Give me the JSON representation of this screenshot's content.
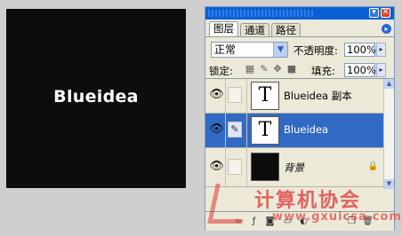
{
  "canvas": {
    "text": "Blueidea",
    "background": "#0d0e0c"
  },
  "panel": {
    "title_buttons": {
      "minimize": "▾",
      "close": "✕"
    },
    "tabs": [
      {
        "label": "图层",
        "active": true
      },
      {
        "label": "通道",
        "active": false
      },
      {
        "label": "路径",
        "active": false
      }
    ],
    "menu_arrow": "▸",
    "blend_mode": "正常",
    "opacity_label": "不透明度:",
    "opacity_value": "100%",
    "lock_label": "锁定:",
    "fill_label": "填充:",
    "fill_value": "100%",
    "layers": [
      {
        "name": "Blueidea 副本",
        "thumb": "T",
        "visible": true,
        "selected": false,
        "italic": false
      },
      {
        "name": "Blueidea",
        "thumb": "T",
        "visible": true,
        "selected": true,
        "italic": false,
        "link_icon": "brush-icon"
      },
      {
        "name": "背景",
        "thumb": "",
        "visible": true,
        "selected": false,
        "italic": true,
        "locked": true
      }
    ]
  },
  "watermark": {
    "text": "计算机协会",
    "url": "www.gxuicsa.com"
  },
  "colors": {
    "selection": "#316ac5",
    "titlebar": "#0a5fd6",
    "watermark": "#e24a4a"
  }
}
